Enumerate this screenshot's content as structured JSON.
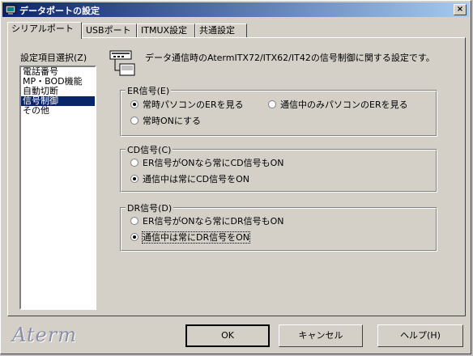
{
  "window": {
    "title": "データポートの設定",
    "close_label": "×"
  },
  "tabs": [
    {
      "label": "シリアルポート",
      "active": true
    },
    {
      "label": "USBポート",
      "active": false
    },
    {
      "label": "ITMUX設定",
      "active": false
    },
    {
      "label": "共通設定",
      "active": false
    }
  ],
  "sidebar": {
    "label": "設定項目選択(Z)",
    "items": [
      "電話番号",
      "MP・BOD機能",
      "自動切断",
      "信号制御",
      "その他"
    ],
    "selected_index": 3
  },
  "description": "データ通信時のAtermITX72/ITX62/IT42の信号制御に関する設定です。",
  "groups": {
    "er": {
      "title": "ER信号(E)",
      "options": [
        "常時パソコンのERを見る",
        "通信中のみパソコンのERを見る",
        "常時ONにする"
      ],
      "selected": 0
    },
    "cd": {
      "title": "CD信号(C)",
      "options": [
        "ER信号がONなら常にCD信号もON",
        "通信中は常にCD信号をON"
      ],
      "selected": 1
    },
    "dr": {
      "title": "DR信号(D)",
      "options": [
        "ER信号がONなら常にDR信号もON",
        "通信中は常にDR信号をON"
      ],
      "selected": 1
    }
  },
  "brand": "Aterm",
  "buttons": {
    "ok": "OK",
    "cancel": "キャンセル",
    "help": "ヘルプ(H)"
  }
}
